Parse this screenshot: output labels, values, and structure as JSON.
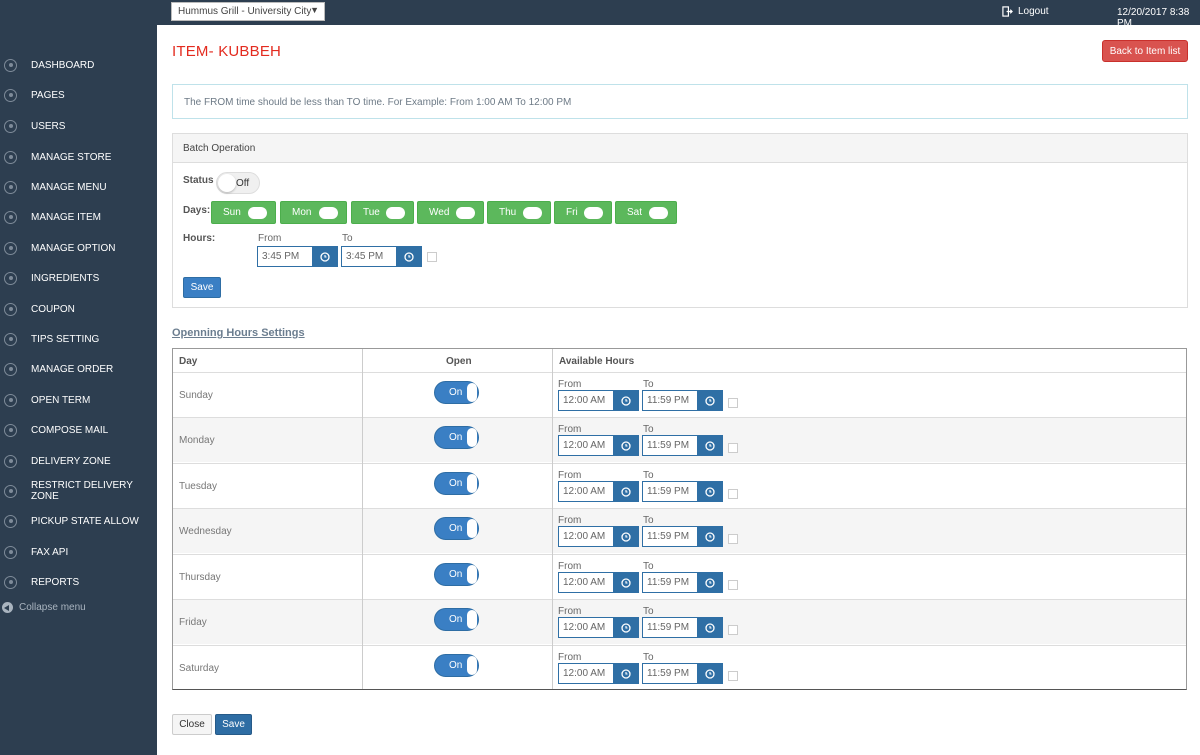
{
  "header": {
    "store_select": "Hummus Grill - University City",
    "logout": "Logout",
    "datetime": "12/20/2017 8:38 PM"
  },
  "sidebar": {
    "items": [
      {
        "label": "DASHBOARD"
      },
      {
        "label": "PAGES"
      },
      {
        "label": "USERS"
      },
      {
        "label": "MANAGE STORE"
      },
      {
        "label": "MANAGE MENU"
      },
      {
        "label": "MANAGE ITEM"
      },
      {
        "label": "MANAGE OPTION"
      },
      {
        "label": "INGREDIENTS"
      },
      {
        "label": "COUPON"
      },
      {
        "label": "TIPS SETTING"
      },
      {
        "label": "MANAGE ORDER"
      },
      {
        "label": "OPEN TERM"
      },
      {
        "label": "COMPOSE MAIL"
      },
      {
        "label": "DELIVERY ZONE"
      },
      {
        "label": "RESTRICT DELIVERY ZONE"
      },
      {
        "label": "PICKUP STATE ALLOW"
      },
      {
        "label": "FAX API"
      },
      {
        "label": "REPORTS"
      }
    ],
    "collapse": "Collapse menu"
  },
  "main": {
    "title": "ITEM- KUBBEH",
    "back_button": "Back to Item list",
    "info": "The FROM time should be less than TO time. For Example: From 1:00 AM To 12:00 PM"
  },
  "batch": {
    "heading": "Batch Operation",
    "status_label": "Status",
    "status_value": "Off",
    "days_label": "Days:",
    "days": [
      "Sun",
      "Mon",
      "Tue",
      "Wed",
      "Thu",
      "Fri",
      "Sat"
    ],
    "hours_label": "Hours:",
    "from_label": "From",
    "to_label": "To",
    "from_value": "3:45 PM",
    "to_value": "3:45 PM",
    "save": "Save"
  },
  "opening": {
    "section_title": "Openning Hours Settings",
    "col_day": "Day",
    "col_open": "Open",
    "col_hours": "Available Hours",
    "from_label": "From",
    "to_label": "To",
    "rows": [
      {
        "day": "Sunday",
        "open": "On",
        "from": "12:00 AM",
        "to": "11:59 PM"
      },
      {
        "day": "Monday",
        "open": "On",
        "from": "12:00 AM",
        "to": "11:59 PM"
      },
      {
        "day": "Tuesday",
        "open": "On",
        "from": "12:00 AM",
        "to": "11:59 PM"
      },
      {
        "day": "Wednesday",
        "open": "On",
        "from": "12:00 AM",
        "to": "11:59 PM"
      },
      {
        "day": "Thursday",
        "open": "On",
        "from": "12:00 AM",
        "to": "11:59 PM"
      },
      {
        "day": "Friday",
        "open": "On",
        "from": "12:00 AM",
        "to": "11:59 PM"
      },
      {
        "day": "Saturday",
        "open": "On",
        "from": "12:00 AM",
        "to": "11:59 PM"
      }
    ]
  },
  "footer": {
    "close": "Close",
    "save": "Save"
  },
  "colors": {
    "sidebar_bg": "#2d3e50",
    "title_red": "#e32b1f",
    "primary_blue": "#2f6fa5",
    "success_green": "#5cb85c",
    "danger_red": "#d9534f"
  },
  "icons": {
    "nav": "circle-nav-icon",
    "logout": "logout-icon",
    "clock": "clock-icon",
    "collapse": "collapse-left-icon"
  }
}
